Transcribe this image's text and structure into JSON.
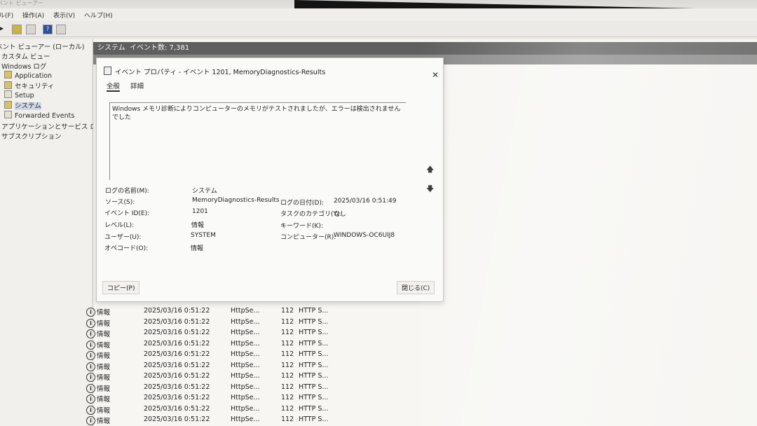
{
  "window": {
    "title": "ベント ビューアー"
  },
  "menu": {
    "items": [
      "ル(F)",
      "操作(A)",
      "表示(V)",
      "ヘルプ(H)"
    ]
  },
  "tree": {
    "items": [
      {
        "label": "ベント ビューアー (ローカル)",
        "icon": "none"
      },
      {
        "label": "カスタム ビュー",
        "icon": "none"
      },
      {
        "label": "Windows ログ",
        "icon": "none"
      },
      {
        "label": "Application",
        "icon": "log-icon"
      },
      {
        "label": "セキュリティ",
        "icon": "log-icon"
      },
      {
        "label": "Setup",
        "icon": "log-icon"
      },
      {
        "label": "システム",
        "icon": "log-icon"
      },
      {
        "label": "Forwarded Events",
        "icon": "log-icon"
      },
      {
        "label": "アプリケーションとサービス ログ",
        "icon": "none"
      },
      {
        "label": "サブスクリプション",
        "icon": "none"
      }
    ]
  },
  "content": {
    "log_name": "システム",
    "event_count": "イベント数: 7,381"
  },
  "dialog": {
    "title": "イベント プロパティ - イベント 1201, MemoryDiagnostics-Results",
    "close": "✕",
    "tabs": [
      "全般",
      "詳細"
    ],
    "message": "Windows メモリ診断によりコンピューターのメモリがテストされましたが、エラーは検出されませんでした",
    "fields": {
      "log_name_label": "ログの名前(M):",
      "log_name_value": "システム",
      "source_label": "ソース(S):",
      "source_value": "MemoryDiagnostics-Results",
      "logged_label": "ログの日付(D):",
      "logged_value": "2025/03/16 0:51:49",
      "event_id_label": "イベント ID(E):",
      "event_id_value": "1201",
      "task_label": "タスクのカテゴリ(Y):",
      "task_value": "なし",
      "level_label": "レベル(L):",
      "level_value": "情報",
      "keyword_label": "キーワード(K):",
      "keyword_value": "",
      "user_label": "ユーザー(U):",
      "user_value": "SYSTEM",
      "computer_label": "コンピューター(R):",
      "computer_value": "WINDOWS-OC6UIJ8",
      "opcode_label": "オペコード(O):",
      "opcode_value": "情報"
    },
    "copy_button": "コピー(P)",
    "close_button": "閉じる(C)"
  },
  "events": [
    {
      "level": "情報",
      "date": "2025/03/16 0:51:22",
      "source": "HttpSe...",
      "id": "112",
      "category": "HTTP S..."
    },
    {
      "level": "情報",
      "date": "2025/03/16 0:51:22",
      "source": "HttpSe...",
      "id": "112",
      "category": "HTTP S..."
    },
    {
      "level": "情報",
      "date": "2025/03/16 0:51:22",
      "source": "HttpSe...",
      "id": "112",
      "category": "HTTP S..."
    },
    {
      "level": "情報",
      "date": "2025/03/16 0:51:22",
      "source": "HttpSe...",
      "id": "112",
      "category": "HTTP S..."
    },
    {
      "level": "情報",
      "date": "2025/03/16 0:51:22",
      "source": "HttpSe...",
      "id": "112",
      "category": "HTTP S..."
    },
    {
      "level": "情報",
      "date": "2025/03/16 0:51:22",
      "source": "HttpSe...",
      "id": "112",
      "category": "HTTP S..."
    },
    {
      "level": "情報",
      "date": "2025/03/16 0:51:22",
      "source": "HttpSe...",
      "id": "112",
      "category": "HTTP S..."
    },
    {
      "level": "情報",
      "date": "2025/03/16 0:51:22",
      "source": "HttpSe...",
      "id": "112",
      "category": "HTTP S..."
    },
    {
      "level": "情報",
      "date": "2025/03/16 0:51:22",
      "source": "HttpSe...",
      "id": "112",
      "category": "HTTP S..."
    },
    {
      "level": "情報",
      "date": "2025/03/16 0:51:22",
      "source": "HttpSe...",
      "id": "112",
      "category": "HTTP S..."
    },
    {
      "level": "情報",
      "date": "2025/03/16 0:51:22",
      "source": "HttpSe...",
      "id": "112",
      "category": "HTTP S..."
    }
  ]
}
